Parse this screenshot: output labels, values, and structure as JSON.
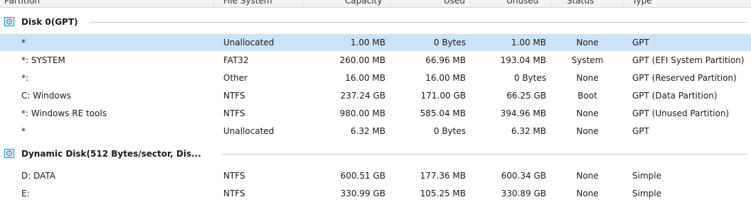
{
  "columns": {
    "partition": "Partition",
    "file_system": "File System",
    "capacity": "Capacity",
    "used": "Used",
    "unused": "Unused",
    "status": "Status",
    "type": "Type"
  },
  "groups": [
    {
      "title": "Disk 0(GPT)",
      "icon": "disk-icon",
      "rows": [
        {
          "partition": "*",
          "file_system": "Unallocated",
          "capacity": "1.00 MB",
          "used": "0 Bytes",
          "unused": "1.00 MB",
          "status": "None",
          "type": "GPT",
          "selected": true
        },
        {
          "partition": "*: SYSTEM",
          "file_system": "FAT32",
          "capacity": "260.00 MB",
          "used": "66.96 MB",
          "unused": "193.04 MB",
          "status": "System",
          "type": "GPT (EFI System Partition)"
        },
        {
          "partition": "*:",
          "file_system": "Other",
          "capacity": "16.00 MB",
          "used": "16.00 MB",
          "unused": "0 Bytes",
          "status": "None",
          "type": "GPT (Reserved Partition)"
        },
        {
          "partition": "C: Windows",
          "file_system": "NTFS",
          "capacity": "237.24 GB",
          "used": "171.00 GB",
          "unused": "66.25 GB",
          "status": "Boot",
          "type": "GPT (Data Partition)"
        },
        {
          "partition": "*: Windows RE tools",
          "file_system": "NTFS",
          "capacity": "980.00 MB",
          "used": "585.04 MB",
          "unused": "394.96 MB",
          "status": "None",
          "type": "GPT (Unused Partition)"
        },
        {
          "partition": "*",
          "file_system": "Unallocated",
          "capacity": "6.32 MB",
          "used": "0 Bytes",
          "unused": "6.32 MB",
          "status": "None",
          "type": "GPT"
        }
      ]
    },
    {
      "title": "Dynamic Disk(512 Bytes/sector, Dis...",
      "icon": "disk-icon",
      "rows": [
        {
          "partition": "D: DATA",
          "file_system": "NTFS",
          "capacity": "600.51 GB",
          "used": "177.36 MB",
          "unused": "600.34 GB",
          "status": "None",
          "type": "Simple"
        },
        {
          "partition": "E:",
          "file_system": "NTFS",
          "capacity": "330.99 GB",
          "used": "105.25 MB",
          "unused": "330.89 GB",
          "status": "None",
          "type": "Simple"
        }
      ]
    }
  ],
  "colors": {
    "selected_row": "#cce4f7",
    "disk_icon": "#1e88c8",
    "group_line": "#c9c9c9"
  }
}
